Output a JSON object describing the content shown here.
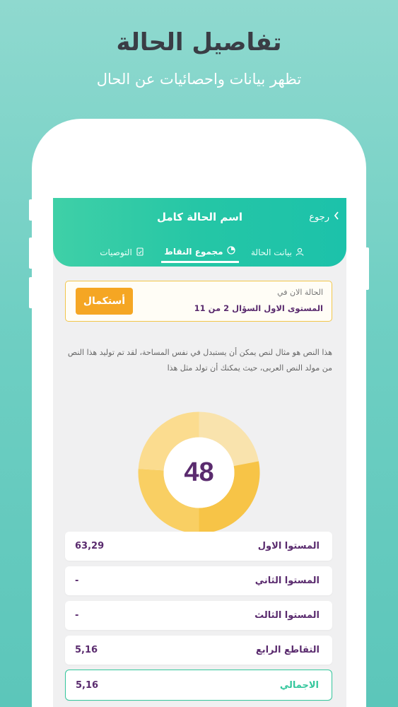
{
  "promo": {
    "title": "تفاصيل الحالة",
    "subtitle": "تظهر بيانات واحصائيات عن الحال"
  },
  "header": {
    "title": "اسم الحالة كامل",
    "back_label": "رجوع"
  },
  "tabs": [
    {
      "label": "بيانت الحالة",
      "icon": "user-icon",
      "active": false
    },
    {
      "label": "مجموع النقاط",
      "icon": "chart-icon",
      "active": true
    },
    {
      "label": "التوصيات",
      "icon": "document-icon",
      "active": false
    }
  ],
  "status": {
    "label": "الحالة الان في",
    "value": "المستوى الاول السؤال 2 من 11",
    "button": "أستكمال"
  },
  "description": "هذا النص هو مثال لنص يمكن أن يستبدل في نفس المساحة، لقد تم توليد هذا النص من مولد النص العربى، حيث يمكنك أن تولد مثل هذا",
  "score": {
    "value": "48",
    "segments": [
      {
        "fraction": 0.22,
        "color": "#f9e3ad"
      },
      {
        "fraction": 0.28,
        "color": "#f7c447"
      },
      {
        "fraction": 0.26,
        "color": "#f9cf63"
      },
      {
        "fraction": 0.24,
        "color": "#fbdc8f"
      }
    ]
  },
  "levels": [
    {
      "name": "المستوا الاول",
      "value": "63,29",
      "total": false
    },
    {
      "name": "المستوا الثاني",
      "value": "-",
      "total": false
    },
    {
      "name": "المستوا الثالث",
      "value": "-",
      "total": false
    },
    {
      "name": "التقاطع الرابع",
      "value": "5,16",
      "total": false
    },
    {
      "name": "الاجمالي",
      "value": "5,16",
      "total": true
    }
  ],
  "colors": {
    "accent": "#25c6a6",
    "button": "#f5a623",
    "text_primary": "#5a2b6e"
  }
}
